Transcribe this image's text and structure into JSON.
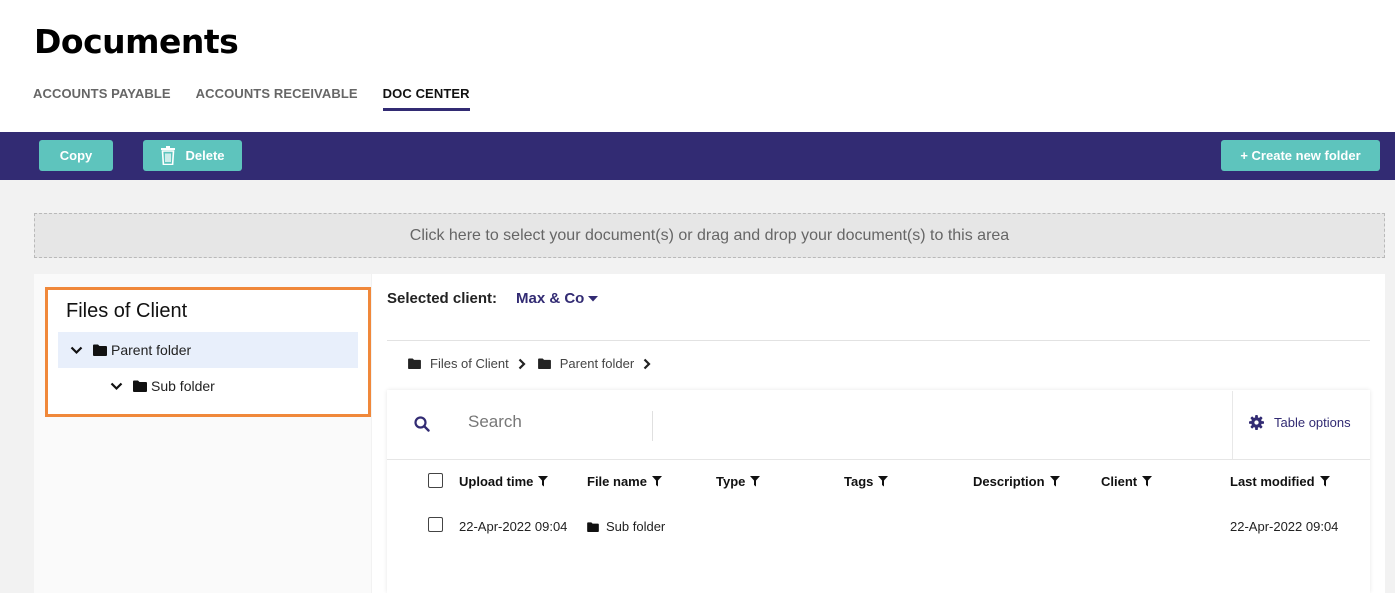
{
  "page": {
    "title": "Documents"
  },
  "tabs": [
    {
      "label": "ACCOUNTS PAYABLE",
      "active": false
    },
    {
      "label": "ACCOUNTS RECEIVABLE",
      "active": false
    },
    {
      "label": "DOC CENTER",
      "active": true
    }
  ],
  "toolbar": {
    "copy_label": "Copy",
    "delete_label": "Delete",
    "create_label": "+ Create new folder"
  },
  "dropzone": {
    "text": "Click here to select your document(s) or drag and drop your document(s) to this area"
  },
  "tree": {
    "title": "Files of Client",
    "items": [
      {
        "label": "Parent folder",
        "expanded": true,
        "selected": true
      },
      {
        "label": "Sub folder",
        "expanded": true,
        "selected": false
      }
    ]
  },
  "client": {
    "label": "Selected client:",
    "value": "Max & Co"
  },
  "breadcrumb": [
    "Files of Client",
    "Parent folder"
  ],
  "search": {
    "placeholder": "Search"
  },
  "table_options_label": "Table options",
  "table": {
    "columns": [
      "Upload time",
      "File name",
      "Type",
      "Tags",
      "Description",
      "Client",
      "Last modified"
    ],
    "rows": [
      {
        "upload_time": "22-Apr-2022 09:04",
        "file_name": "Sub folder",
        "type": "",
        "tags": "",
        "description": "",
        "client": "",
        "last_modified": "22-Apr-2022 09:04"
      }
    ]
  },
  "colors": {
    "accent": "#322b73",
    "button": "#5ec4bd",
    "highlight_border": "#f0883a",
    "selected_row": "#e8effb"
  }
}
